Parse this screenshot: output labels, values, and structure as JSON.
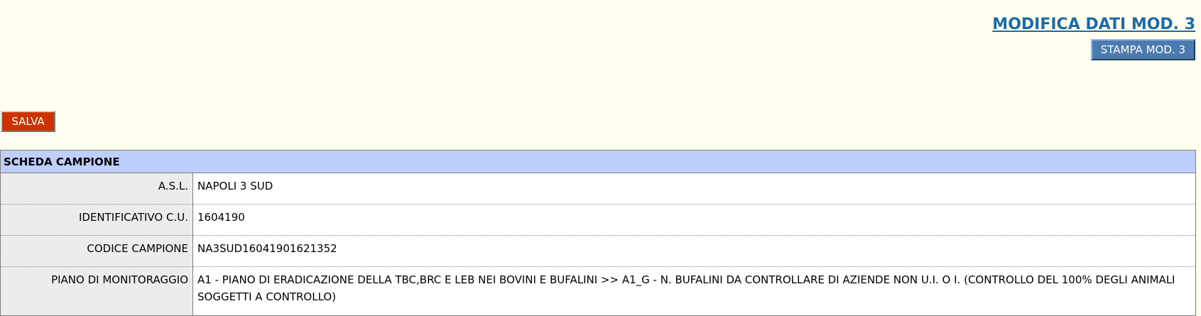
{
  "header": {
    "title": "MODIFICA DATI MOD. 3",
    "print_button_label": "STAMPA MOD. 3"
  },
  "actions": {
    "save_label": "SALVA"
  },
  "scheda": {
    "title": "SCHEDA CAMPIONE",
    "rows": [
      {
        "label": "A.S.L.",
        "value": "NAPOLI 3 SUD"
      },
      {
        "label": "IDENTIFICATIVO C.U.",
        "value": "1604190"
      },
      {
        "label": "CODICE CAMPIONE",
        "value": "NA3SUD16041901621352"
      },
      {
        "label": "PIANO DI MONITORAGGIO",
        "value": "A1 - PIANO DI ERADICAZIONE DELLA TBC,BRC E LEB NEI BOVINI E BUFALINI >> A1_G - N. BUFALINI DA CONTROLLARE DI AZIENDE NON U.I. O I. (CONTROLLO DEL 100% DEGLI ANIMALI SOGGETTI A CONTROLLO)"
      }
    ]
  },
  "colors": {
    "page_background": "#fffff0",
    "title_link": "#1c6aa8",
    "print_button": "#4b7bb0",
    "save_button": "#cc3300",
    "table_header": "#bfcdff",
    "label_cell": "#ececec"
  }
}
